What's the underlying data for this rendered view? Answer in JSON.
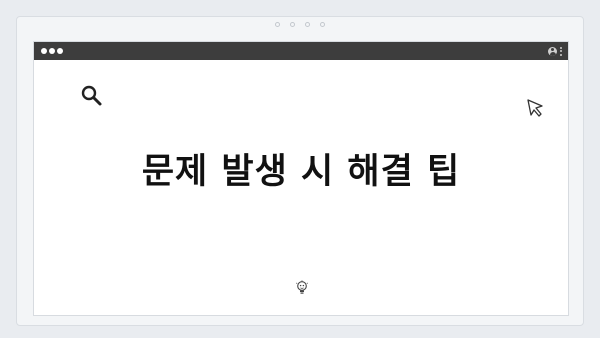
{
  "window": {
    "controls": [
      "close",
      "minimize",
      "maximize"
    ],
    "toolbar_icons": [
      "user-icon",
      "kebab-menu-icon"
    ]
  },
  "slide": {
    "title": "문제 발생 시 해결 팁",
    "icons": [
      "search-icon",
      "cursor-icon",
      "lightbulb-icon"
    ]
  },
  "colors": {
    "background": "#e9ecf0",
    "titlebar": "#3d3d3d",
    "canvas": "#ffffff",
    "text": "#111111"
  }
}
